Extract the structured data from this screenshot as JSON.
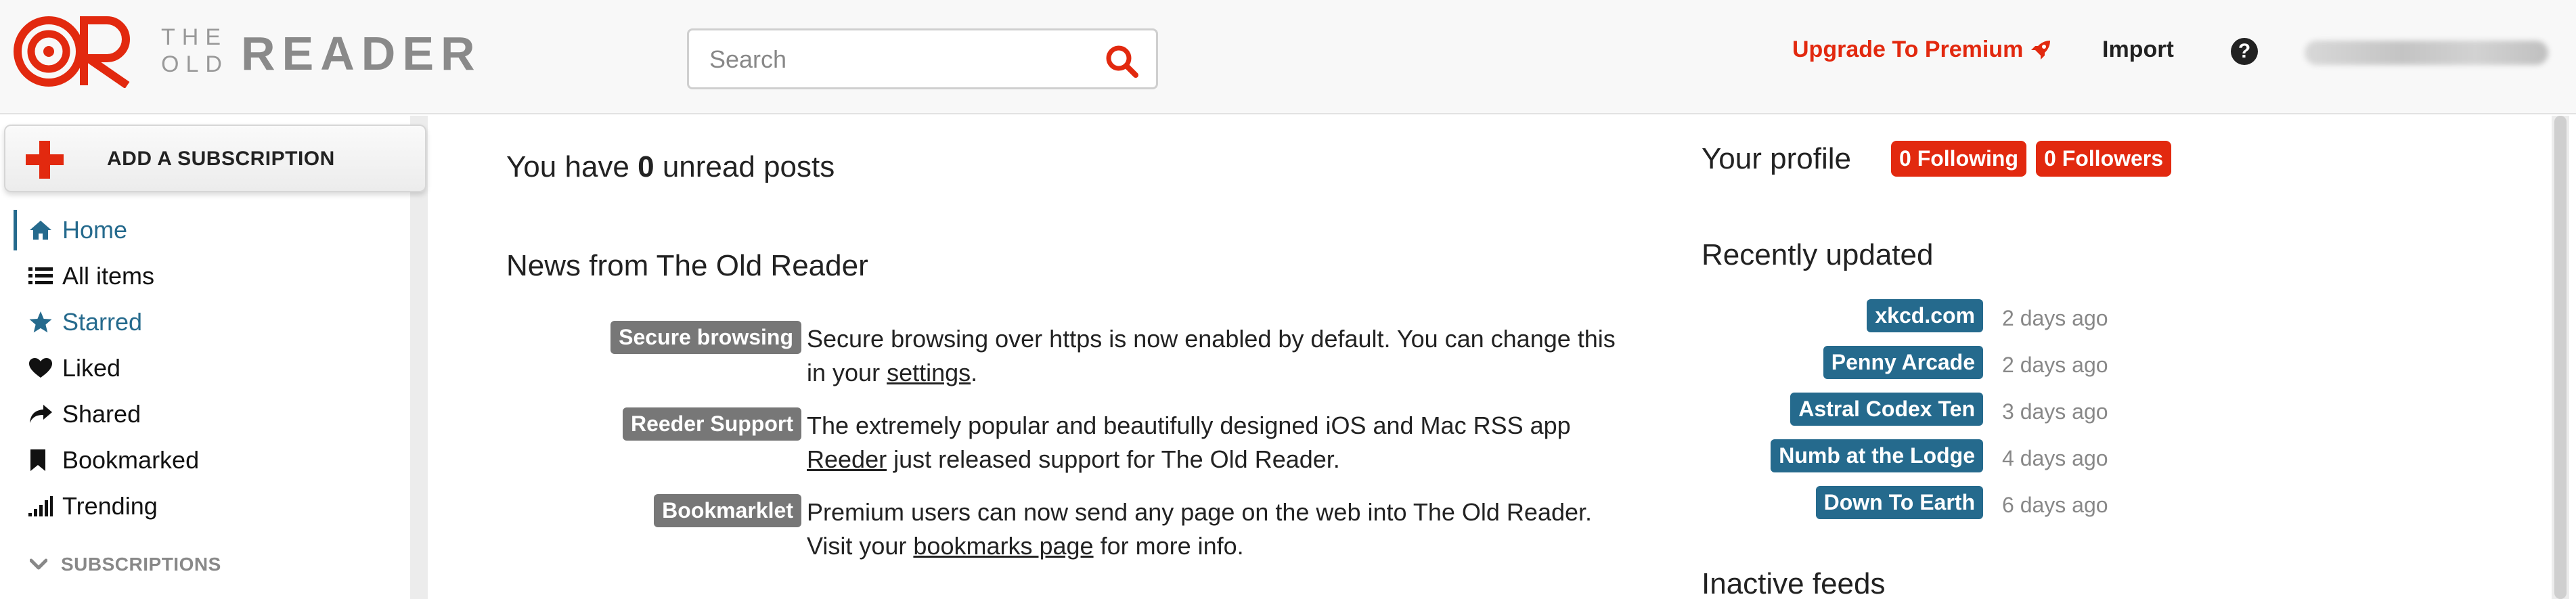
{
  "header": {
    "logo": {
      "line1": "THE",
      "line2": "OLD",
      "wordmark": "READER"
    },
    "search": {
      "placeholder": "Search",
      "value": ""
    },
    "upgrade_label": "Upgrade To Premium",
    "import_label": "Import",
    "help_label": "?"
  },
  "sidebar": {
    "add_subscription_label": "ADD A SUBSCRIPTION",
    "items": [
      {
        "label": "Home",
        "icon": "home-icon",
        "active": true
      },
      {
        "label": "All items",
        "icon": "list-icon"
      },
      {
        "label": "Starred",
        "icon": "star-icon"
      },
      {
        "label": "Liked",
        "icon": "heart-icon"
      },
      {
        "label": "Shared",
        "icon": "share-icon"
      },
      {
        "label": "Bookmarked",
        "icon": "bookmark-icon"
      },
      {
        "label": "Trending",
        "icon": "signal-icon"
      }
    ],
    "subscriptions_label": "SUBSCRIPTIONS"
  },
  "main": {
    "unread_prefix": "You have ",
    "unread_count": "0",
    "unread_suffix": " unread posts",
    "news_title": "News from The Old Reader",
    "news": [
      {
        "badge": "Secure browsing",
        "text_before": "Secure browsing over https is now enabled by default. You can change this in your ",
        "link": "settings",
        "text_after": "."
      },
      {
        "badge": "Reeder Support",
        "text_before": "The extremely popular and beautifully designed iOS and Mac RSS app ",
        "link": "Reeder",
        "text_after": " just released support for The Old Reader."
      },
      {
        "badge": "Bookmarklet",
        "text_before": "Premium users can now send any page on the web into The Old Reader. Visit your ",
        "link": "bookmarks page",
        "text_after": " for more info."
      }
    ]
  },
  "right": {
    "profile_title": "Your profile",
    "following_label": "0 Following",
    "followers_label": "0 Followers",
    "recent_title": "Recently updated",
    "recent": [
      {
        "name": "xkcd.com",
        "time": "2 days ago"
      },
      {
        "name": "Penny Arcade",
        "time": "2 days ago"
      },
      {
        "name": "Astral Codex Ten",
        "time": "3 days ago"
      },
      {
        "name": "Numb at the Lodge",
        "time": "4 days ago"
      },
      {
        "name": "Down To Earth",
        "time": "6 days ago"
      }
    ],
    "inactive_title": "Inactive feeds"
  },
  "colors": {
    "brand_red": "#e2290f",
    "accent_blue": "#256a8d",
    "badge_gray": "#777777"
  }
}
